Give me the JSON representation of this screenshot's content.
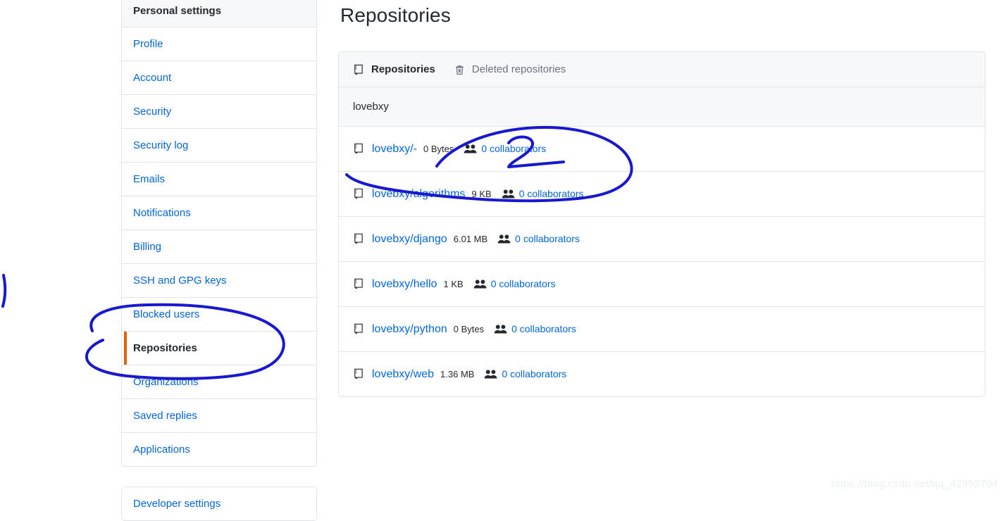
{
  "sidebar": {
    "header": "Personal settings",
    "items": [
      {
        "label": "Profile",
        "active": false
      },
      {
        "label": "Account",
        "active": false
      },
      {
        "label": "Security",
        "active": false
      },
      {
        "label": "Security log",
        "active": false
      },
      {
        "label": "Emails",
        "active": false
      },
      {
        "label": "Notifications",
        "active": false
      },
      {
        "label": "Billing",
        "active": false
      },
      {
        "label": "SSH and GPG keys",
        "active": false
      },
      {
        "label": "Blocked users",
        "active": false
      },
      {
        "label": "Repositories",
        "active": true
      },
      {
        "label": "Organizations",
        "active": false
      },
      {
        "label": "Saved replies",
        "active": false
      },
      {
        "label": "Applications",
        "active": false
      }
    ],
    "developer_settings": "Developer settings",
    "active_indicator_color": "#e36209"
  },
  "main": {
    "page_title": "Repositories",
    "tabs": [
      {
        "label": "Repositories",
        "icon": "repo-icon",
        "active": true
      },
      {
        "label": "Deleted repositories",
        "icon": "trash-icon",
        "active": false
      }
    ],
    "owner": "lovebxy",
    "repositories": [
      {
        "name": "lovebxy/-",
        "size": "0 Bytes",
        "collaborators": "0 collaborators"
      },
      {
        "name": "lovebxy/algorithms",
        "size": "9 KB",
        "collaborators": "0 collaborators"
      },
      {
        "name": "lovebxy/django",
        "size": "6.01 MB",
        "collaborators": "0 collaborators"
      },
      {
        "name": "lovebxy/hello",
        "size": "1 KB",
        "collaborators": "0 collaborators"
      },
      {
        "name": "lovebxy/python",
        "size": "0 Bytes",
        "collaborators": "0 collaborators"
      },
      {
        "name": "lovebxy/web",
        "size": "1.36 MB",
        "collaborators": "0 collaborators"
      }
    ]
  },
  "annotations": {
    "color": "#1718d0",
    "marker_label": "2"
  },
  "watermark": "https://blog.csdn.net/qq_42992704",
  "colors": {
    "link": "#0366d6",
    "text": "#24292e",
    "muted": "#6a737d",
    "border": "#e1e4e8",
    "surface": "#f6f8fa",
    "accent_orange": "#e36209"
  }
}
